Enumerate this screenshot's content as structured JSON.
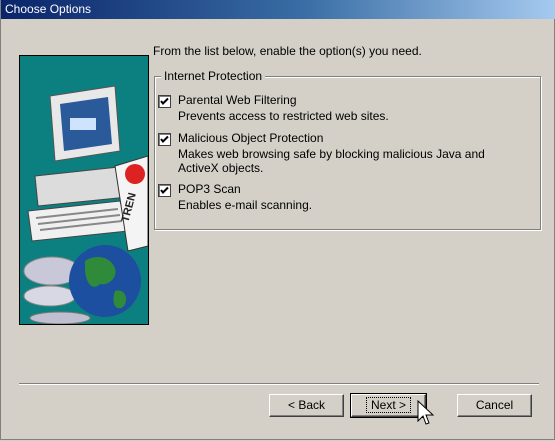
{
  "window": {
    "title": "Choose Options"
  },
  "intro_text": "From the list below, enable the option(s) you need.",
  "group": {
    "legend": "Internet Protection",
    "options": [
      {
        "label": "Parental Web Filtering",
        "checked": true,
        "description": "Prevents access to restricted web sites."
      },
      {
        "label": "Malicious Object Protection",
        "checked": true,
        "description": "Makes web browsing safe by blocking malicious Java and ActiveX objects."
      },
      {
        "label": "POP3 Scan",
        "checked": true,
        "description": "Enables e-mail scanning."
      }
    ]
  },
  "buttons": {
    "back": "< Back",
    "next": "Next >",
    "cancel": "Cancel"
  },
  "art": {
    "description_icon": "computer-globe-cd-art",
    "brand_text": "TREN"
  },
  "colors": {
    "accent_teal": "#0c8080",
    "titlebar": "#0a246a"
  }
}
